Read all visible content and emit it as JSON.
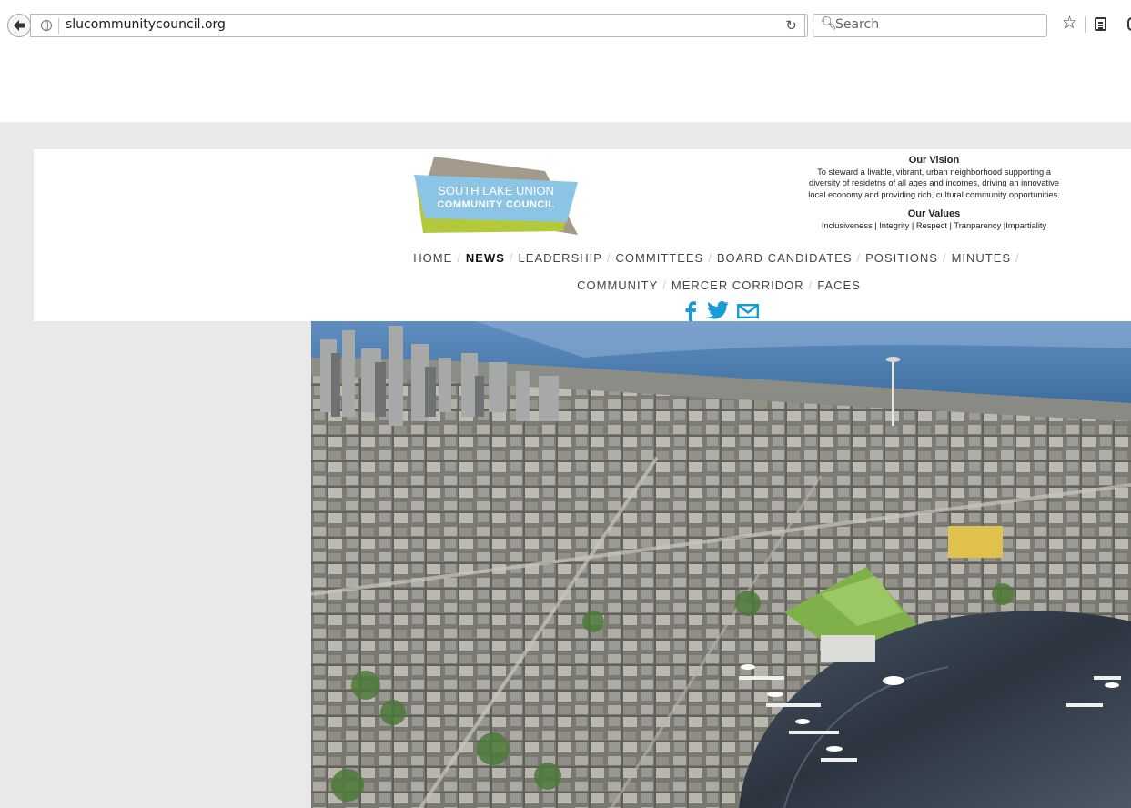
{
  "browser": {
    "url": "slucommunitycouncil.org",
    "search_placeholder": "Search"
  },
  "logo": {
    "line1": "SOUTH LAKE UNION",
    "line2": "COMMUNITY COUNCIL"
  },
  "vision": {
    "title": "Our Vision",
    "lines": [
      "To steward a livable, vibrant, urban neighborhood supporting a",
      "diversity of residetns of all ages and incomes, driving an innovative",
      "local economy and providing rich, cultural community opportunities."
    ],
    "values_title": "Our Values",
    "values_text": "Inclusiveness | Integrity | Respect | Tranparency |Impartiality"
  },
  "nav": {
    "row1": [
      "HOME",
      "NEWS",
      "LEADERSHIP",
      "COMMITTEES",
      "BOARD CANDIDATES",
      "POSITIONS",
      "MINUTES"
    ],
    "row2": [
      "COMMUNITY",
      "MERCER CORRIDOR",
      "FACES"
    ],
    "active": "NEWS"
  },
  "colors": {
    "accent_blue": "#1a9ad6",
    "logo_blue": "#8cc4e6",
    "logo_green": "#b4c83c",
    "logo_gray": "#a39a8c"
  },
  "icons": [
    "facebook-icon",
    "twitter-icon",
    "email-icon"
  ]
}
